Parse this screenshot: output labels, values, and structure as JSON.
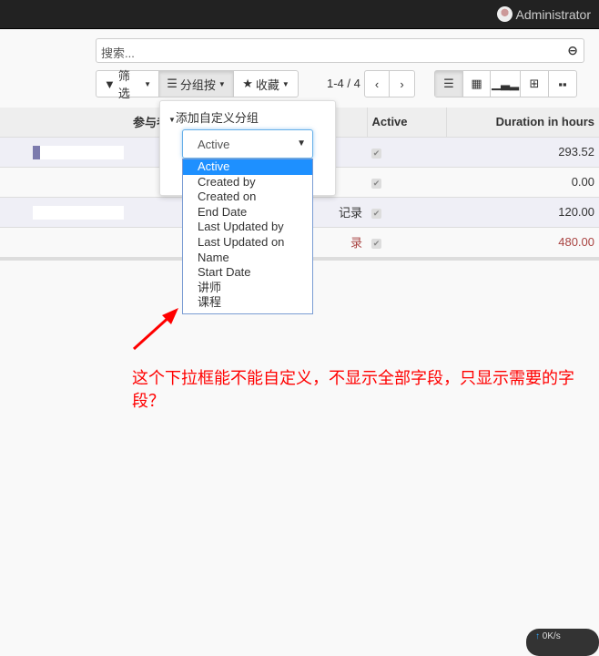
{
  "topbar": {
    "user": "Administrator"
  },
  "search": {
    "placeholder": "搜索..."
  },
  "toolbar": {
    "filter": "筛选",
    "groupby": "分组按",
    "favorites": "收藏",
    "pager": "1-4 / 4"
  },
  "table": {
    "columns": [
      "参与者",
      "Active",
      "Duration in hours"
    ],
    "rows": [
      {
        "partial": "",
        "active": true,
        "duration": "293.52"
      },
      {
        "partial": "",
        "active": true,
        "duration": "0.00"
      },
      {
        "partial": "记录",
        "active": true,
        "duration": "120.00"
      },
      {
        "partial": "录",
        "active": true,
        "duration": "480.00",
        "color": "#a94442"
      }
    ]
  },
  "groupby_popup": {
    "title": "添加自定义分组",
    "selected": "Active",
    "options": [
      "Active",
      "Created by",
      "Created on",
      "End Date",
      "Last Updated by",
      "Last Updated on",
      "Name",
      "Start Date",
      "讲师",
      "课程"
    ]
  },
  "annotation": {
    "text": "这个下拉框能不能自定义，不显示全部字段，只显示需要的字段？",
    "color": "#ff0000"
  },
  "network_widget": {
    "text": "0K/s"
  }
}
